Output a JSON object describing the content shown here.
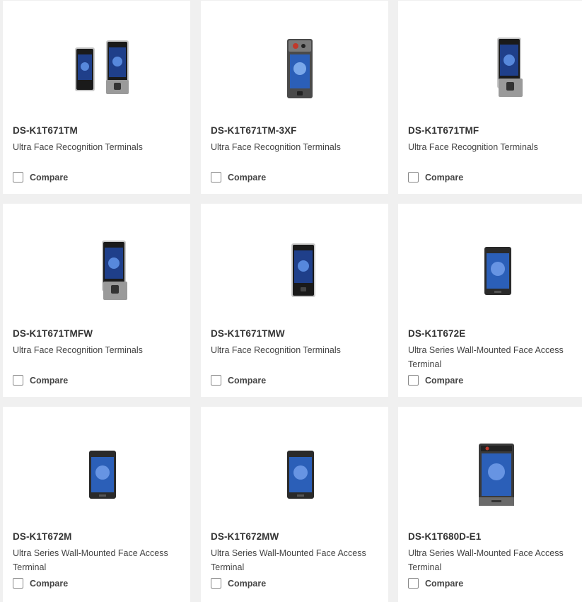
{
  "compare_label": "Compare",
  "products": [
    {
      "model": "DS-K1T671TM",
      "description": "Ultra Face Recognition Terminals",
      "image": "dual-face-terminal-with-fingerprint"
    },
    {
      "model": "DS-K1T671TM-3XF",
      "description": "Ultra Face Recognition Terminals",
      "image": "face-terminal-with-thermal-camera"
    },
    {
      "model": "DS-K1T671TMF",
      "description": "Ultra Face Recognition Terminals",
      "image": "face-terminal-with-fingerprint"
    },
    {
      "model": "DS-K1T671TMFW",
      "description": "Ultra Face Recognition Terminals",
      "image": "face-terminal-with-fingerprint"
    },
    {
      "model": "DS-K1T671TMW",
      "description": "Ultra Face Recognition Terminals",
      "image": "face-terminal"
    },
    {
      "model": "DS-K1T672E",
      "description": "Ultra Series Wall-Mounted Face Access Terminal",
      "image": "wall-mounted-terminal"
    },
    {
      "model": "DS-K1T672M",
      "description": "Ultra Series Wall-Mounted Face Access Terminal",
      "image": "wall-mounted-terminal"
    },
    {
      "model": "DS-K1T672MW",
      "description": "Ultra Series Wall-Mounted Face Access Terminal",
      "image": "wall-mounted-terminal"
    },
    {
      "model": "DS-K1T680D-E1",
      "description": "Ultra Series Wall-Mounted Face Access Terminal",
      "image": "wall-mounted-terminal-large"
    }
  ]
}
